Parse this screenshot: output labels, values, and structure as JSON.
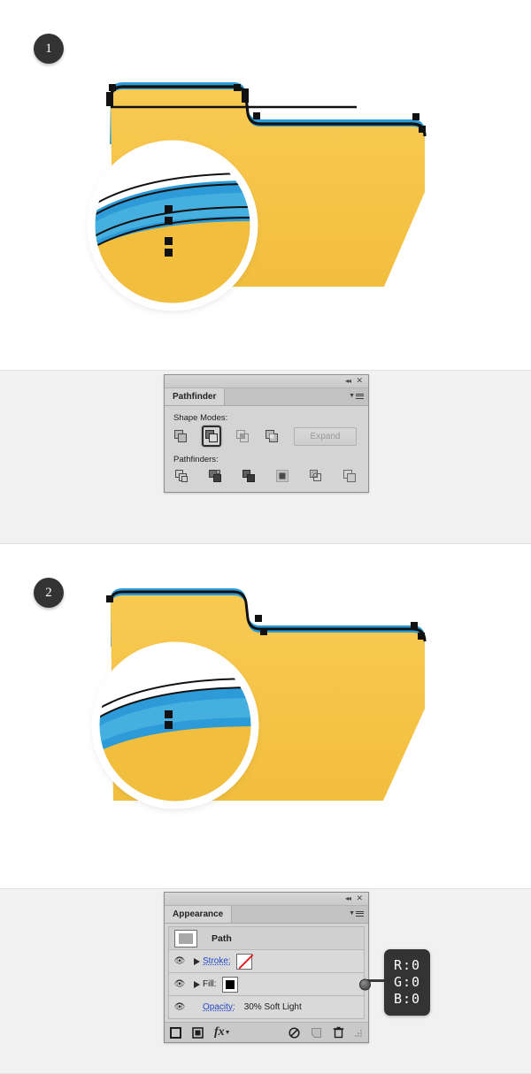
{
  "tutorial": {
    "steps": [
      {
        "number": "1"
      },
      {
        "number": "2"
      }
    ]
  },
  "colors": {
    "folder_body": "#F7C348",
    "folder_shadow": "#E8B13C",
    "stripe_blue": "#2D9BD7",
    "stripe_blue_light": "#45B0E0",
    "outline": "#0D0D0D",
    "panel_bg": "#D4D4D4",
    "section_bg": "#F1F1F1",
    "link_blue": "#2346C8",
    "callout_bg": "#333333"
  },
  "pathfinder_panel": {
    "tab_label": "Pathfinder",
    "titlebar": {
      "collapse_icon": "double-chevron-left-icon",
      "close_icon": "close-icon"
    },
    "menu_icon": "panel-menu-icon",
    "shape_modes_label": "Shape Modes:",
    "pathfinders_label": "Pathfinders:",
    "expand_label": "Expand",
    "expand_enabled": false,
    "shape_modes": [
      {
        "name": "unite",
        "selected": false
      },
      {
        "name": "minus-front",
        "selected": true
      },
      {
        "name": "intersect",
        "selected": false
      },
      {
        "name": "exclude",
        "selected": false
      }
    ],
    "pathfinders": [
      {
        "name": "divide"
      },
      {
        "name": "trim"
      },
      {
        "name": "merge"
      },
      {
        "name": "crop"
      },
      {
        "name": "outline"
      },
      {
        "name": "minus-back"
      }
    ]
  },
  "appearance_panel": {
    "tab_label": "Appearance",
    "titlebar": {
      "collapse_icon": "double-chevron-left-icon",
      "close_icon": "close-icon"
    },
    "menu_icon": "panel-menu-icon",
    "target_name": "Path",
    "rows": [
      {
        "label": "Stroke:",
        "swatch": "none",
        "has_eye": true,
        "has_disclosure": true
      },
      {
        "label": "Fill:",
        "swatch": "black",
        "has_eye": true,
        "has_disclosure": true
      },
      {
        "label": "Opacity:",
        "value": "30% Soft Light",
        "has_eye": true,
        "has_disclosure": false
      }
    ],
    "footer_icons": [
      {
        "name": "add-new-stroke-icon"
      },
      {
        "name": "add-new-fill-icon"
      },
      {
        "name": "add-new-effect-icon"
      },
      {
        "name": "clear-appearance-icon"
      },
      {
        "name": "duplicate-item-icon"
      },
      {
        "name": "delete-item-icon"
      },
      {
        "name": "resize-grip-icon"
      }
    ]
  },
  "callout": {
    "lines": [
      "R:0",
      "G:0",
      "B:0"
    ]
  },
  "artwork": {
    "step1": {
      "description": "folder-with-blue-outline-stripes",
      "magnifier": "zoom-detail-circle"
    },
    "step2": {
      "description": "folder-with-merged-blue-stripe",
      "magnifier": "zoom-detail-circle"
    }
  }
}
